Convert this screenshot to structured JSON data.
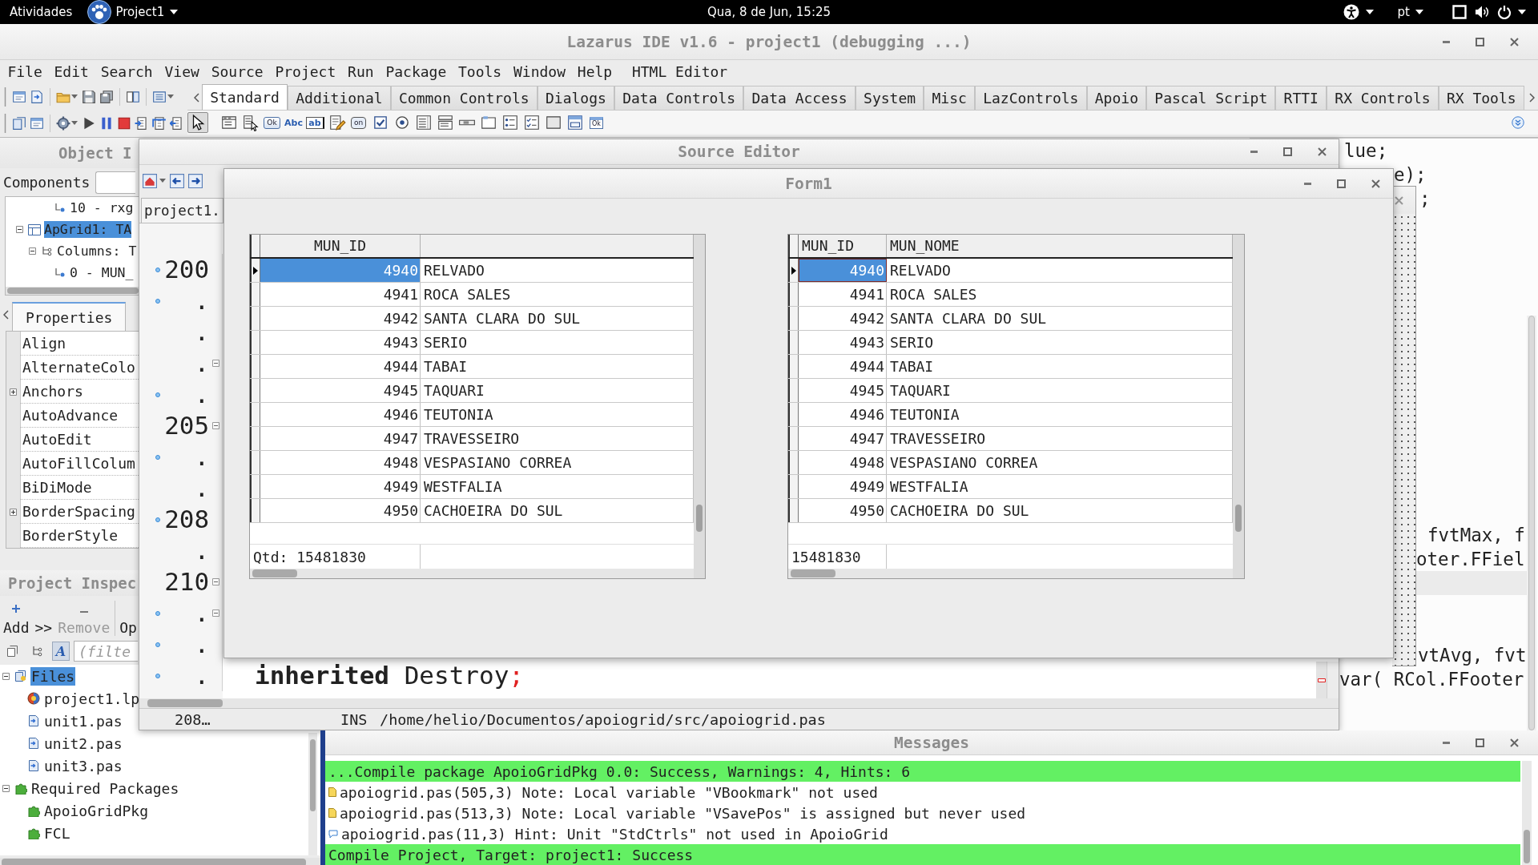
{
  "top_bar": {
    "activities": "Atividades",
    "app_menu": "Project1",
    "clock": "Qua, 8 de Jun, 15:25",
    "keyboard_layout": "pt"
  },
  "main_window": {
    "title": "Lazarus IDE v1.6 - project1 (debugging ...)",
    "menu": [
      "File",
      "Edit",
      "Search",
      "View",
      "Source",
      "Project",
      "Run",
      "Package",
      "Tools",
      "Window",
      "Help",
      "HTML Editor"
    ],
    "palette_tabs": [
      {
        "label": "Standard",
        "selected": true
      },
      {
        "label": "Additional",
        "selected": false
      },
      {
        "label": "Common Controls",
        "selected": false
      },
      {
        "label": "Dialogs",
        "selected": false
      },
      {
        "label": "Data Controls",
        "selected": false
      },
      {
        "label": "Data Access",
        "selected": false
      },
      {
        "label": "System",
        "selected": false
      },
      {
        "label": "Misc",
        "selected": false
      },
      {
        "label": "LazControls",
        "selected": false
      },
      {
        "label": "Apoio",
        "selected": false
      },
      {
        "label": "Pascal Script",
        "selected": false
      },
      {
        "label": "RTTI",
        "selected": false
      },
      {
        "label": "RX Controls",
        "selected": false
      },
      {
        "label": "RX Tools",
        "selected": false
      }
    ],
    "components": [
      {
        "kind": "pointer",
        "selected": true
      },
      {
        "kind": "main_menu",
        "selected": false
      },
      {
        "kind": "popup_menu",
        "selected": false
      },
      {
        "kind": "button",
        "label": "Ok",
        "selected": false
      },
      {
        "kind": "label",
        "label": "Abc",
        "selected": false
      },
      {
        "kind": "edit",
        "label": "ab",
        "selected": false
      },
      {
        "kind": "memo",
        "selected": false
      },
      {
        "kind": "toggle",
        "label": "on",
        "selected": false
      },
      {
        "kind": "checkbox",
        "selected": false
      },
      {
        "kind": "radio",
        "selected": false
      },
      {
        "kind": "listbox",
        "selected": false
      },
      {
        "kind": "combobox",
        "selected": false
      },
      {
        "kind": "scrollbar",
        "selected": false
      },
      {
        "kind": "groupbox",
        "selected": false
      },
      {
        "kind": "radiogroup",
        "selected": false
      },
      {
        "kind": "checkgroup",
        "selected": false
      },
      {
        "kind": "panel",
        "selected": false
      },
      {
        "kind": "frame",
        "selected": false
      },
      {
        "kind": "actionlist",
        "label": "Ok",
        "selected": false
      }
    ]
  },
  "object_inspector": {
    "title": "Object I",
    "components_label": "Components",
    "tree": [
      {
        "children": [
          {
            "children": [
              {
                "label": "10 - rxg",
                "kind": "column",
                "selected": false
              }
            ]
          }
        ]
      },
      {
        "label": "ApGrid1: TA",
        "kind": "component",
        "selected": true,
        "expanded": true,
        "children": [
          {
            "label": "Columns: T",
            "kind": "collection",
            "selected": false,
            "expanded": true,
            "children": [
              {
                "label": "0 - MUN_",
                "kind": "column",
                "selected": false
              }
            ]
          }
        ]
      }
    ],
    "tabs": [
      {
        "label": "Properties",
        "selected": true
      }
    ],
    "properties": [
      {
        "name": "Align",
        "expandable": false
      },
      {
        "name": "AlternateColo",
        "expandable": false
      },
      {
        "name": "Anchors",
        "expandable": true
      },
      {
        "name": "AutoAdvance",
        "expandable": false
      },
      {
        "name": "AutoEdit",
        "expandable": false
      },
      {
        "name": "AutoFillColum",
        "expandable": false
      },
      {
        "name": "BiDiMode",
        "expandable": false
      },
      {
        "name": "BorderSpacing",
        "expandable": true
      },
      {
        "name": "BorderStyle",
        "expandable": false
      }
    ]
  },
  "project_inspector": {
    "title": "Project Inspec",
    "buttons": [
      {
        "kind": "add",
        "label": "Add",
        "disabled": false
      },
      {
        "kind": "more",
        "label": ">>",
        "disabled": false
      },
      {
        "kind": "remove",
        "label": "Remove",
        "disabled": true
      },
      {
        "kind": "options",
        "label": "Op",
        "disabled": false
      }
    ],
    "filter_toggles": [
      {
        "kind": "documents",
        "pressed": false
      },
      {
        "kind": "tree",
        "pressed": false
      },
      {
        "kind": "alphabetical",
        "label": "A",
        "pressed": true
      }
    ],
    "filter_placeholder": "(filte",
    "tree": [
      {
        "label": "Files",
        "kind": "files",
        "selected": true,
        "expanded": true,
        "children": [
          {
            "label": "project1.lp",
            "kind": "project",
            "selected": false
          },
          {
            "label": "unit1.pas",
            "kind": "unit",
            "selected": false
          },
          {
            "label": "unit2.pas",
            "kind": "unit",
            "selected": false
          },
          {
            "label": "unit3.pas",
            "kind": "unit",
            "selected": false
          }
        ]
      },
      {
        "label": "Required Packages",
        "kind": "packages",
        "selected": false,
        "expanded": true,
        "children": [
          {
            "label": "ApoioGridPkg",
            "kind": "package",
            "selected": false
          },
          {
            "label": "FCL",
            "kind": "package",
            "selected": false
          }
        ]
      }
    ]
  },
  "source_editor": {
    "title": "Source Editor",
    "tab": "project1.",
    "lines": [
      {
        "number": "200",
        "executable": true,
        "fold": false
      },
      {
        "number": ".",
        "executable": true,
        "fold": false
      },
      {
        "number": ".",
        "executable": false,
        "fold": false
      },
      {
        "number": ".",
        "executable": false,
        "fold": true
      },
      {
        "number": ".",
        "executable": true,
        "fold": false
      },
      {
        "number": "205",
        "executable": false,
        "fold": true
      },
      {
        "number": ".",
        "executable": true,
        "fold": false
      },
      {
        "number": ".",
        "executable": false,
        "fold": false
      },
      {
        "number": "208",
        "executable": true,
        "fold": false
      },
      {
        "number": ".",
        "executable": false,
        "fold": false
      },
      {
        "number": "210",
        "executable": false,
        "fold": true
      },
      {
        "number": ".",
        "executable": true,
        "fold": true
      },
      {
        "number": ".",
        "executable": true,
        "fold": false
      },
      {
        "number": ".",
        "executable": true,
        "fold": false,
        "tokens": [
          {
            "text": "inherited",
            "kind": "keyword"
          },
          {
            "text": "Destroy",
            "kind": "identifier"
          },
          {
            "text": ";",
            "kind": "symbol"
          }
        ]
      }
    ],
    "status": {
      "position": "208…",
      "mode": "INS",
      "path": "/home/helio/Documentos/apoiogrid/src/apoiogrid.pas"
    }
  },
  "back_editor": {
    "lines": [
      {
        "text": "lue;",
        "highlighted": false
      },
      {
        "text": "e);",
        "highlighted": false
      },
      {
        "text": ";",
        "highlighted": false
      },
      {
        "text": "fvtMax, f",
        "highlighted": false
      },
      {
        "text": "oter.FFiel",
        "highlighted": false
      },
      {
        "highlighted": true
      },
      {
        "text": "vtAvg, fvt",
        "highlighted": false
      },
      {
        "text": "var( RCol.FFooter",
        "highlighted": false
      }
    ]
  },
  "form1": {
    "title": "Form1",
    "grids": [
      {
        "focused": false,
        "columns": [
          {
            "title": "MUN_ID",
            "centered": true
          }
        ],
        "rows": [
          {
            "id": "4940",
            "name": "RELVADO",
            "selected": true
          },
          {
            "id": "4941",
            "name": "ROCA SALES",
            "selected": false
          },
          {
            "id": "4942",
            "name": "SANTA CLARA DO SUL",
            "selected": false
          },
          {
            "id": "4943",
            "name": "SERIO",
            "selected": false
          },
          {
            "id": "4944",
            "name": "TABAI",
            "selected": false
          },
          {
            "id": "4945",
            "name": "TAQUARI",
            "selected": false
          },
          {
            "id": "4946",
            "name": "TEUTONIA",
            "selected": false
          },
          {
            "id": "4947",
            "name": "TRAVESSEIRO",
            "selected": false
          },
          {
            "id": "4948",
            "name": "VESPASIANO CORREA",
            "selected": false
          },
          {
            "id": "4949",
            "name": "WESTFALIA",
            "selected": false
          },
          {
            "id": "4950",
            "name": "CACHOEIRA DO SUL",
            "selected": false
          }
        ],
        "footer": "Qtd: 15481830"
      },
      {
        "focused": true,
        "columns": [
          {
            "title": "MUN_ID",
            "centered": false
          },
          {
            "title": "MUN_NOME",
            "centered": false
          }
        ],
        "rows": [
          {
            "id": "4940",
            "name": "RELVADO",
            "selected": true
          },
          {
            "id": "4941",
            "name": "ROCA SALES",
            "selected": false
          },
          {
            "id": "4942",
            "name": "SANTA CLARA DO SUL",
            "selected": false
          },
          {
            "id": "4943",
            "name": "SERIO",
            "selected": false
          },
          {
            "id": "4944",
            "name": "TABAI",
            "selected": false
          },
          {
            "id": "4945",
            "name": "TAQUARI",
            "selected": false
          },
          {
            "id": "4946",
            "name": "TEUTONIA",
            "selected": false
          },
          {
            "id": "4947",
            "name": "TRAVESSEIRO",
            "selected": false
          },
          {
            "id": "4948",
            "name": "VESPASIANO CORREA",
            "selected": false
          },
          {
            "id": "4949",
            "name": "WESTFALIA",
            "selected": false
          },
          {
            "id": "4950",
            "name": "CACHOEIRA DO SUL",
            "selected": false
          }
        ],
        "footer": "15481830"
      }
    ]
  },
  "messages": {
    "title": "Messages",
    "items": [
      {
        "kind": "success",
        "text": "...Compile package ApoioGridPkg 0.0: Success, Warnings: 4, Hints: 6"
      },
      {
        "kind": "note",
        "text": "apoiogrid.pas(505,3) Note: Local variable \"VBookmark\" not used"
      },
      {
        "kind": "note",
        "text": "apoiogrid.pas(513,3) Note: Local variable \"VSavePos\" is assigned but never used"
      },
      {
        "kind": "hint",
        "text": "apoiogrid.pas(11,3) Hint: Unit \"StdCtrls\" not used in ApoioGrid"
      },
      {
        "kind": "success",
        "text": "Compile Project, Target: project1: Success"
      }
    ]
  }
}
